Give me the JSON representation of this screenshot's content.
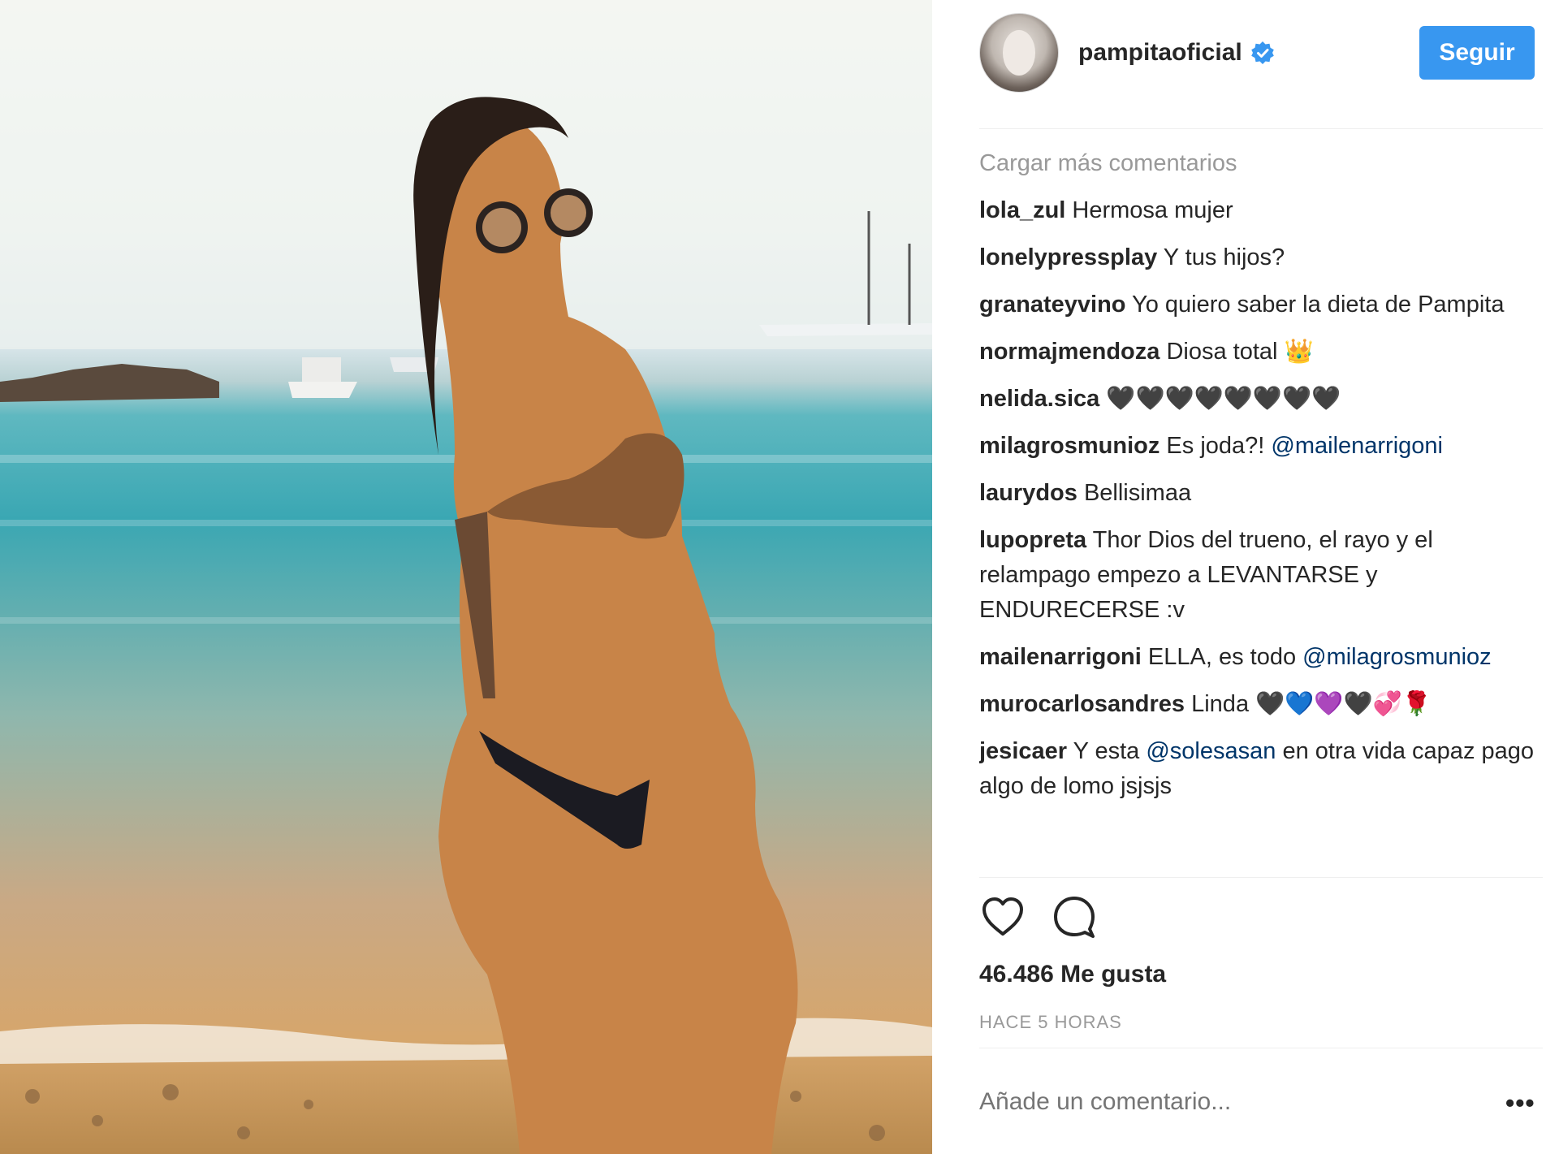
{
  "post": {
    "username": "pampitaoficial",
    "follow_label": "Seguir",
    "load_more": "Cargar más comentarios",
    "comments": [
      {
        "user": "lola_zul",
        "text": "Hermosa mujer"
      },
      {
        "user": "lonelypressplay",
        "text": "Y tus hijos?"
      },
      {
        "user": "granateyvino",
        "text": "Yo quiero saber la dieta de Pampita"
      },
      {
        "user": "normajmendoza",
        "text": "Diosa total 👑"
      },
      {
        "user": "nelida.sica",
        "text": "🖤🖤🖤🖤🖤🖤🖤🖤"
      },
      {
        "user": "milagrosmunioz",
        "text": "Es joda?!",
        "mention": "@mailenarrigoni"
      },
      {
        "user": "laurydos",
        "text": "Bellisimaa"
      },
      {
        "user": "lupopreta",
        "text": "Thor Dios del trueno, el rayo y el relampago empezo a LEVANTARSE y ENDURECERSE :v"
      },
      {
        "user": "mailenarrigoni",
        "text": "ELLA, es todo",
        "mention": "@milagrosmunioz"
      },
      {
        "user": "murocarlosandres",
        "text": "Linda 🖤💙💜🖤💞🌹"
      },
      {
        "user": "jesicaer",
        "text": "Y esta",
        "mention": "@solesasan",
        "text_after": "en otra vida capaz pago algo de lomo jsjsjs"
      }
    ],
    "likes_text": "46.486 Me gusta",
    "time_ago": "HACE 5 HORAS",
    "add_comment_placeholder": "Añade un comentario...",
    "more_options": "•••"
  },
  "colors": {
    "accent": "#3897f0",
    "mention": "#003569",
    "muted": "#999999"
  },
  "icons": [
    "verified-badge-icon",
    "heart-icon",
    "comment-icon",
    "more-options-icon"
  ]
}
